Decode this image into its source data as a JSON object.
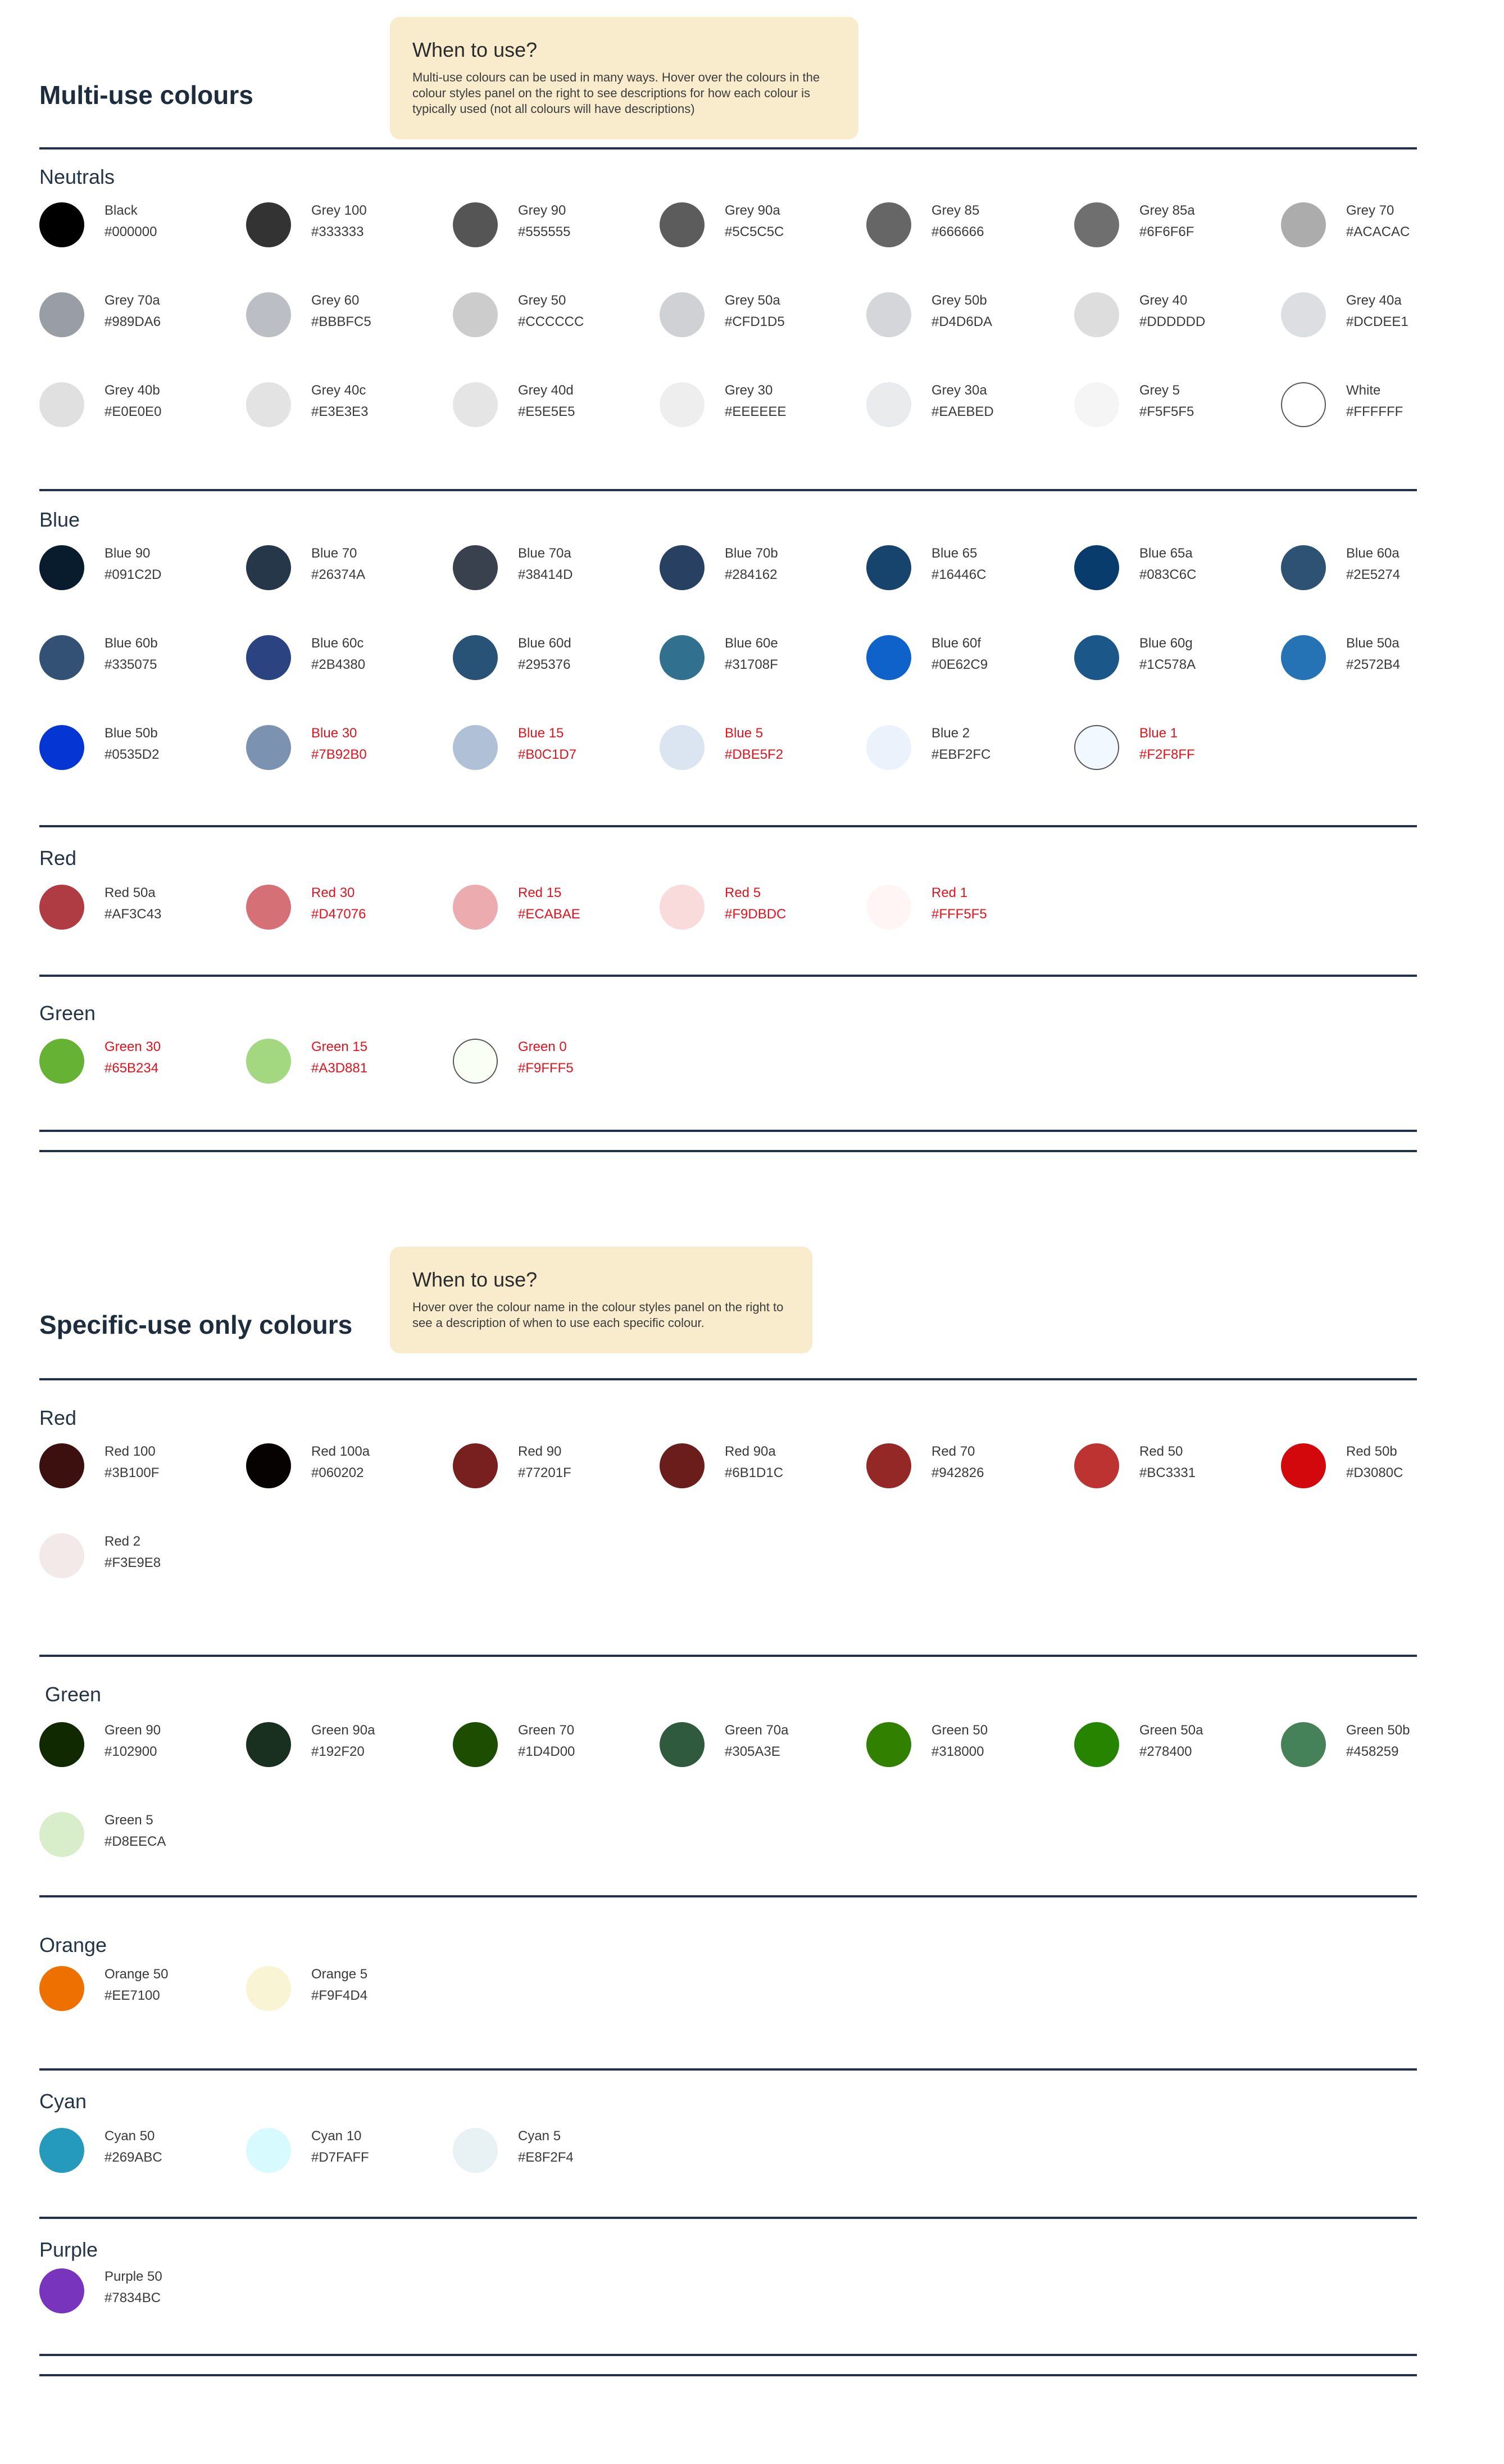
{
  "multi_use": {
    "title": "Multi-use colours",
    "note_title": "When to use?",
    "note_body": "Multi-use colours can be used in many ways. Hover over the colours in the colour styles panel on the right to see descriptions for how each colour is typically used (not all colours will have descriptions)",
    "groups": [
      {
        "title": "Neutrals",
        "swatches": [
          {
            "name": "Black",
            "hex": "#000000",
            "color": "#000000"
          },
          {
            "name": "Grey 100",
            "hex": "#333333",
            "color": "#333333"
          },
          {
            "name": "Grey 90",
            "hex": "#555555",
            "color": "#555555"
          },
          {
            "name": "Grey 90a",
            "hex": "#5C5C5C",
            "color": "#5C5C5C"
          },
          {
            "name": "Grey 85",
            "hex": "#666666",
            "color": "#666666"
          },
          {
            "name": "Grey 85a",
            "hex": "#6F6F6F",
            "color": "#6F6F6F"
          },
          {
            "name": "Grey 70",
            "hex": "#ACACAC",
            "color": "#ACACAC"
          },
          {
            "name": "Grey 70a",
            "hex": "#989DA6",
            "color": "#989DA6"
          },
          {
            "name": "Grey 60",
            "hex": "#BBBFC5",
            "color": "#BBBFC5"
          },
          {
            "name": "Grey 50",
            "hex": "#CCCCCC",
            "color": "#CCCCCC"
          },
          {
            "name": "Grey 50a",
            "hex": "#CFD1D5",
            "color": "#CFD1D5"
          },
          {
            "name": "Grey 50b",
            "hex": "#D4D6DA",
            "color": "#D4D6DA"
          },
          {
            "name": "Grey 40",
            "hex": "#DDDDDD",
            "color": "#DDDDDD"
          },
          {
            "name": "Grey 40a",
            "hex": "#DCDEE1",
            "color": "#DCDEE1"
          },
          {
            "name": "Grey 40b",
            "hex": "#E0E0E0",
            "color": "#E0E0E0"
          },
          {
            "name": "Grey 40c",
            "hex": "#E3E3E3",
            "color": "#E3E3E3"
          },
          {
            "name": "Grey 40d",
            "hex": "#E5E5E5",
            "color": "#E5E5E5"
          },
          {
            "name": "Grey 30",
            "hex": "#EEEEEE",
            "color": "#EEEEEE"
          },
          {
            "name": "Grey 30a",
            "hex": "#EAEBED",
            "color": "#EAEBED"
          },
          {
            "name": "Grey 5",
            "hex": "#F5F5F5",
            "color": "#F5F5F5"
          },
          {
            "name": "White",
            "hex": "#FFFFFF",
            "color": "#FFFFFF",
            "outlined": true
          }
        ]
      },
      {
        "title": "Blue",
        "swatches": [
          {
            "name": "Blue 90",
            "hex": "#091C2D",
            "color": "#091C2D"
          },
          {
            "name": "Blue 70",
            "hex": "#26374A",
            "color": "#26374A"
          },
          {
            "name": "Blue 70a",
            "hex": "#38414D",
            "color": "#38414D"
          },
          {
            "name": "Blue 70b",
            "hex": "#284162",
            "color": "#284162"
          },
          {
            "name": "Blue 65",
            "hex": "#16446C",
            "color": "#16446C"
          },
          {
            "name": "Blue 65a",
            "hex": "#083C6C",
            "color": "#083C6C"
          },
          {
            "name": "Blue 60a",
            "hex": "#2E5274",
            "color": "#2E5274"
          },
          {
            "name": "Blue 60b",
            "hex": "#335075",
            "color": "#335075"
          },
          {
            "name": "Blue 60c",
            "hex": "#2B4380",
            "color": "#2B4380"
          },
          {
            "name": "Blue 60d",
            "hex": "#295376",
            "color": "#295376"
          },
          {
            "name": "Blue 60e",
            "hex": "#31708F",
            "color": "#31708F"
          },
          {
            "name": "Blue 60f",
            "hex": "#0E62C9",
            "color": "#0E62C9"
          },
          {
            "name": "Blue 60g",
            "hex": "#1C578A",
            "color": "#1C578A"
          },
          {
            "name": "Blue 50a",
            "hex": "#2572B4",
            "color": "#2572B4"
          },
          {
            "name": "Blue 50b",
            "hex": "#0535D2",
            "color": "#0535D2"
          },
          {
            "name": "Blue 30",
            "hex": "#7B92B0",
            "color": "#7B92B0",
            "red": true
          },
          {
            "name": "Blue 15",
            "hex": "#B0C1D7",
            "color": "#B0C1D7",
            "red": true
          },
          {
            "name": "Blue 5",
            "hex": "#DBE5F2",
            "color": "#DBE5F2",
            "red": true
          },
          {
            "name": "Blue 2",
            "hex": "#EBF2FC",
            "color": "#EBF2FC"
          },
          {
            "name": "Blue 1",
            "hex": "#F2F8FF",
            "color": "#F2F8FF",
            "red": true,
            "outlined": true
          }
        ]
      },
      {
        "title": "Red",
        "swatches": [
          {
            "name": "Red 50a",
            "hex": "#AF3C43",
            "color": "#AF3C43"
          },
          {
            "name": "Red 30",
            "hex": "#D47076",
            "color": "#D47076",
            "red": true
          },
          {
            "name": "Red 15",
            "hex": "#ECABAE",
            "color": "#ECABAE",
            "red": true
          },
          {
            "name": "Red 5",
            "hex": "#F9DBDC",
            "color": "#F9DBDC",
            "red": true
          },
          {
            "name": "Red 1",
            "hex": "#FFF5F5",
            "color": "#FFF5F5",
            "red": true
          }
        ]
      },
      {
        "title": "Green",
        "swatches": [
          {
            "name": "Green 30",
            "hex": "#65B234",
            "color": "#65B234",
            "red": true
          },
          {
            "name": "Green 15",
            "hex": "#A3D881",
            "color": "#A3D881",
            "red": true
          },
          {
            "name": "Green 0",
            "hex": "#F9FFF5",
            "color": "#F9FFF5",
            "red": true,
            "outlined": true
          }
        ]
      }
    ]
  },
  "specific_use": {
    "title": "Specific-use only colours",
    "note_title": "When to use?",
    "note_body": "Hover over the colour name in the colour styles panel on the right to see a description of when to use each specific colour.",
    "groups": [
      {
        "title": "Red",
        "swatches": [
          {
            "name": "Red 100",
            "hex": "#3B100F",
            "color": "#3B100F"
          },
          {
            "name": "Red 100a",
            "hex": "#060202",
            "color": "#060202"
          },
          {
            "name": "Red 90",
            "hex": "#77201F",
            "color": "#77201F"
          },
          {
            "name": "Red 90a",
            "hex": "#6B1D1C",
            "color": "#6B1D1C"
          },
          {
            "name": "Red 70",
            "hex": "#942826",
            "color": "#942826"
          },
          {
            "name": "Red 50",
            "hex": "#BC3331",
            "color": "#BC3331"
          },
          {
            "name": "Red 50b",
            "hex": "#D3080C",
            "color": "#D3080C"
          },
          {
            "name": "Red 2",
            "hex": "#F3E9E8",
            "color": "#F3E9E8"
          }
        ]
      },
      {
        "title": "Green",
        "swatches": [
          {
            "name": "Green 90",
            "hex": "#102900",
            "color": "#102900"
          },
          {
            "name": "Green 90a",
            "hex": "#192F20",
            "color": "#192F20"
          },
          {
            "name": "Green 70",
            "hex": "#1D4D00",
            "color": "#1D4D00"
          },
          {
            "name": "Green 70a",
            "hex": "#305A3E",
            "color": "#305A3E"
          },
          {
            "name": "Green 50",
            "hex": "#318000",
            "color": "#318000"
          },
          {
            "name": "Green 50a",
            "hex": "#278400",
            "color": "#278400"
          },
          {
            "name": "Green 50b",
            "hex": "#458259",
            "color": "#458259"
          },
          {
            "name": "Green 5",
            "hex": "#D8EECA",
            "color": "#D8EECA"
          }
        ]
      },
      {
        "title": "Orange",
        "swatches": [
          {
            "name": "Orange 50",
            "hex": "#EE7100",
            "color": "#EE7100"
          },
          {
            "name": "Orange 5",
            "hex": "#F9F4D4",
            "color": "#F9F4D4"
          }
        ]
      },
      {
        "title": "Cyan",
        "swatches": [
          {
            "name": "Cyan 50",
            "hex": "#269ABC",
            "color": "#269ABC"
          },
          {
            "name": "Cyan 10",
            "hex": "#D7FAFF",
            "color": "#D7FAFF"
          },
          {
            "name": "Cyan 5",
            "hex": "#E8F2F4",
            "color": "#E8F2F4"
          }
        ]
      },
      {
        "title": "Purple",
        "swatches": [
          {
            "name": "Purple 50",
            "hex": "#7834BC",
            "color": "#7834BC"
          }
        ]
      }
    ]
  }
}
